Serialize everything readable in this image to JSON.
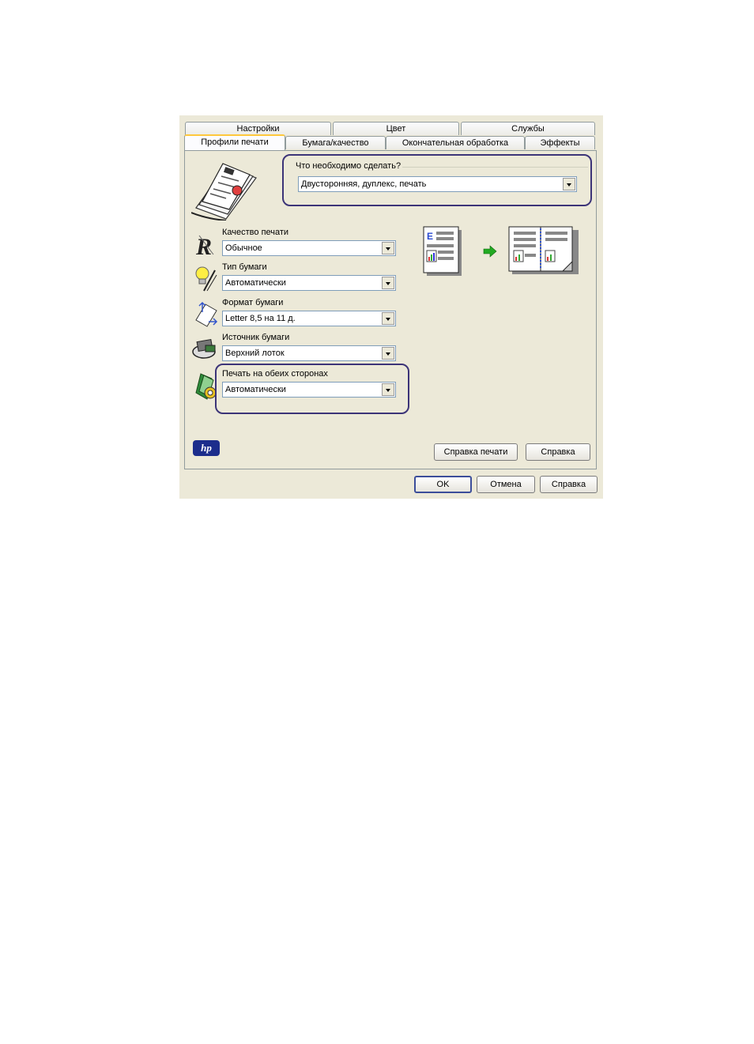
{
  "tabs_back": [
    {
      "label": "Настройки"
    },
    {
      "label": "Цвет"
    },
    {
      "label": "Службы"
    }
  ],
  "tabs_front": [
    {
      "label": "Профили печати",
      "active": true
    },
    {
      "label": "Бумага/качество"
    },
    {
      "label": "Окончательная обработка"
    },
    {
      "label": "Эффекты"
    }
  ],
  "task": {
    "question": "Что необходимо сделать?",
    "value": "Двусторонняя, дуплекс, печать"
  },
  "fields": {
    "print_quality": {
      "label": "Качество печати",
      "value": "Обычное"
    },
    "paper_type": {
      "label": "Тип бумаги",
      "value": "Автоматически"
    },
    "paper_size": {
      "label": "Формат бумаги",
      "value": "Letter 8,5 на 11 д."
    },
    "paper_source": {
      "label": "Источник бумаги",
      "value": "Верхний лоток"
    },
    "duplex": {
      "label": "Печать на обеих сторонах",
      "value": "Автоматически"
    }
  },
  "buttons": {
    "print_help": "Справка печати",
    "help_inner": "Справка",
    "ok": "OK",
    "cancel": "Отмена",
    "help": "Справка"
  },
  "logo": {
    "text": "hp"
  },
  "preview": {
    "letter": "E"
  },
  "colors": {
    "highlight": "#3c3478",
    "dialog_bg": "#ece9d8",
    "tab_accent": "#ffc83c",
    "arrow": "#22aa22"
  }
}
